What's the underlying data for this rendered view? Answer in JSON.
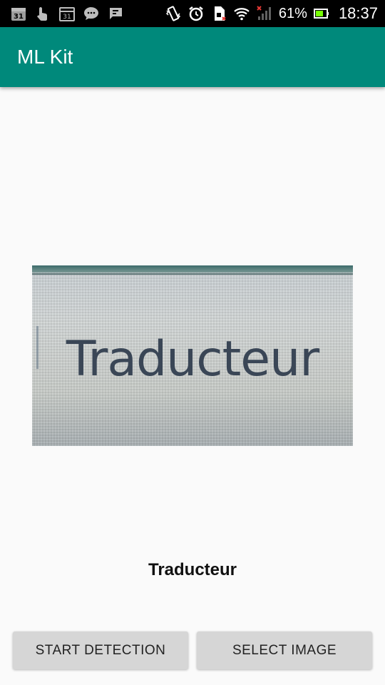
{
  "status_bar": {
    "left_icons": [
      "calendar-31-icon",
      "touch-icon",
      "calendar-icon",
      "chat-icon",
      "message-icon"
    ],
    "calendar_day": "31",
    "right_icons": [
      "vibrate-icon",
      "alarm-icon",
      "sim-icon",
      "wifi-icon",
      "signal-icon",
      "battery-icon"
    ],
    "battery_percent": "61%",
    "time": "18:37"
  },
  "app_bar": {
    "title": "ML Kit",
    "color": "#00897b"
  },
  "preview": {
    "image_text": "Traducteur"
  },
  "result": {
    "text": "Traducteur"
  },
  "buttons": {
    "start": "START DETECTION",
    "select": "SELECT IMAGE"
  }
}
